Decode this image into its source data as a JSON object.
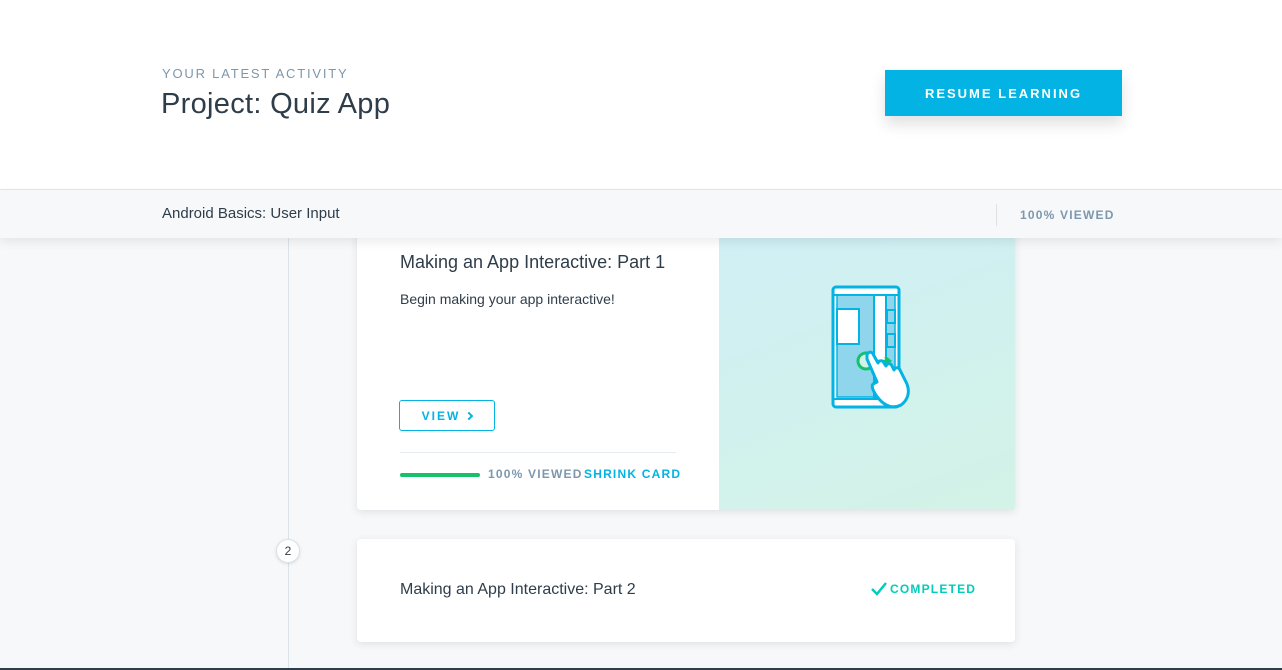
{
  "header": {
    "eyebrow": "YOUR LATEST ACTIVITY",
    "title": "Project: Quiz App",
    "resume_label": "RESUME LEARNING",
    "accent_color": "#02b3e4"
  },
  "lesson_bar": {
    "title": "Android Basics: User Input",
    "progress_label": "100% VIEWED"
  },
  "timeline": {
    "step_number": "2"
  },
  "cards": [
    {
      "title": "Making an App Interactive: Part 1",
      "description": "Begin making your app interactive!",
      "view_label": "VIEW",
      "progress": 1.0,
      "progress_label": "100% VIEWED",
      "shrink_label": "SHRINK CARD",
      "illustration": "phone-touch-swipe-icon",
      "progress_color": "#15c26b"
    },
    {
      "title": "Making an App Interactive: Part 2",
      "status_label": "COMPLETED",
      "status_icon": "checkmark-icon",
      "status_color": "#02ccba"
    }
  ]
}
